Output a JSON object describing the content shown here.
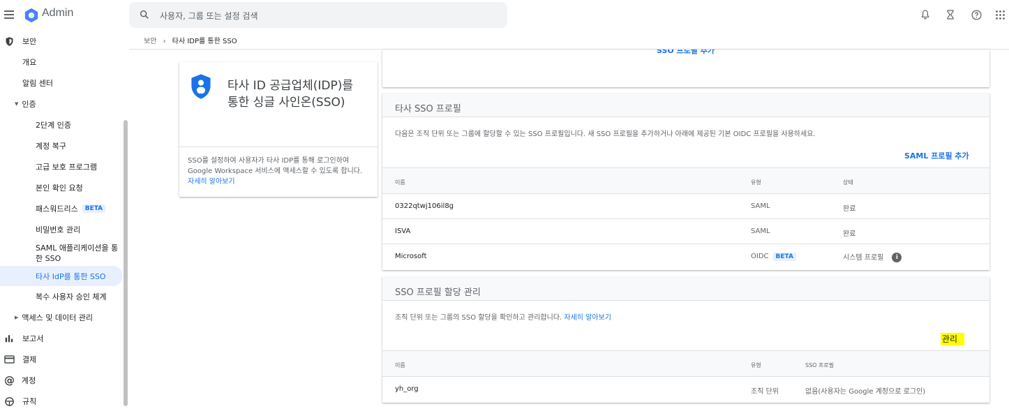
{
  "app": {
    "title": "Admin"
  },
  "search": {
    "placeholder": "사용자, 그룹 또는 설정 검색"
  },
  "sidebar": {
    "security": "보안",
    "overview": "개요",
    "alert_center": "알림 센터",
    "auth": "인증",
    "auth_items": [
      {
        "label": "2단계 인증"
      },
      {
        "label": "계정 복구"
      },
      {
        "label": "고급 보호 프로그램"
      },
      {
        "label": "본인 확인 요청"
      },
      {
        "label": "패스워드리스",
        "badge": "BETA"
      },
      {
        "label": "비밀번호 관리"
      },
      {
        "label": "SAML 애플리케이션을 통한 SSO"
      },
      {
        "label": "타사 IdP를 통한 SSO"
      },
      {
        "label": "복수 사용자 승인 체계"
      }
    ],
    "access_data": "액세스 및 데이터 관리",
    "reports": "보고서",
    "billing": "결제",
    "account": "계정",
    "rules": "규칙"
  },
  "breadcrumb": {
    "parent": "보안",
    "sep": "›",
    "current": "타사 IDP를 통한 SSO"
  },
  "top_card_partial_link": "SSO 프로필 추가",
  "info_card": {
    "title": "타사 ID 공급업체(IDP)를 통한 싱글 사인온(SSO)",
    "desc": "SSO를 설정하여 사용자가 타사 IDP를 통해 로그인하여 Google Workspace 서비스에 액세스할 수 있도록 합니다.",
    "link": "자세히 알아보기"
  },
  "sso_profiles": {
    "title": "타사 SSO 프로필",
    "desc": "다음은 조직 단위 또는 그룹에 할당할 수 있는 SSO 프로필입니다. 새 SSO 프로필을 추가하거나 아래에 제공된 기본 OIDC 프로필을 사용하세요.",
    "action": "SAML 프로필 추가",
    "columns": {
      "name": "이름",
      "type": "유형",
      "status": "상태"
    },
    "rows": [
      {
        "name": "0322qtwj106il8g",
        "type": "SAML",
        "status": "완료"
      },
      {
        "name": "ISVA",
        "type": "SAML",
        "status": "완료"
      },
      {
        "name": "Microsoft",
        "type": "OIDC",
        "badge": "BETA",
        "status": "시스템 프로필",
        "info_glyph": "i"
      }
    ]
  },
  "assignment": {
    "title": "SSO 프로필 할당 관리",
    "desc": "조직 단위 또는 그룹의 SSO 할당을 확인하고 관리합니다.",
    "link": "자세히 알아보기",
    "action": "관리",
    "columns": {
      "name": "이름",
      "type": "유형",
      "profile": "SSO 프로필"
    },
    "rows": [
      {
        "name": "yh_org",
        "type": "조직 단위",
        "profile": "없음(사용자는 Google 계정으로 로그인)"
      }
    ]
  },
  "colors": {
    "accent": "#1a73e8",
    "highlight": "#ffff00"
  },
  "icons": [
    "menu-icon",
    "admin-logo-icon",
    "search-icon",
    "notifications-icon",
    "hourglass-icon",
    "help-icon",
    "apps-icon",
    "shield-icon",
    "reports-icon",
    "billing-icon",
    "account-icon",
    "rules-icon",
    "info-icon",
    "caret-down-icon",
    "caret-right-icon"
  ]
}
